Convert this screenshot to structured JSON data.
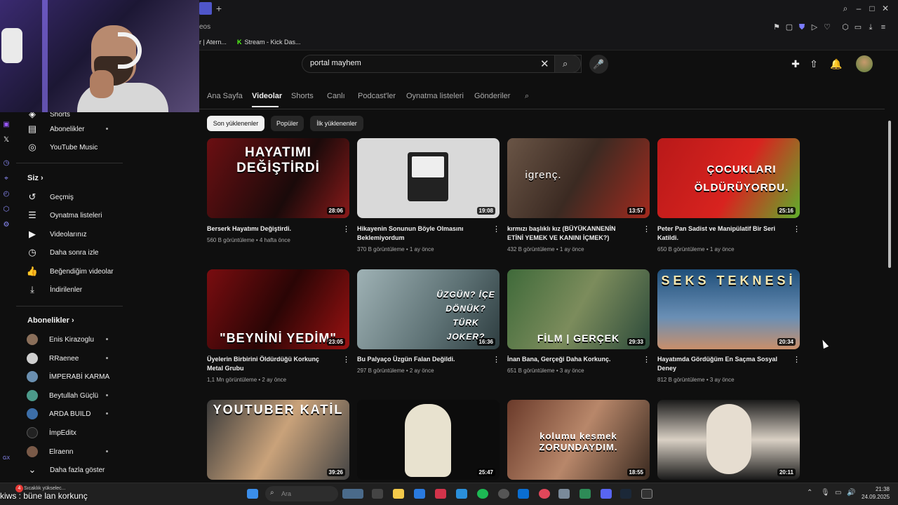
{
  "browser": {
    "url_fragment": "eos",
    "new_tab_label": "+",
    "bookmarks": [
      {
        "label": "r | Atern..."
      },
      {
        "label": "Stream - Kick Das..."
      }
    ],
    "window_controls": {
      "minimize": "–",
      "maximize": "□",
      "close": "✕"
    }
  },
  "search": {
    "query": "portal mayhem",
    "clear_icon": "✕",
    "search_icon": "⌕",
    "mic_icon": "🎤"
  },
  "sidebar": {
    "items_top": [
      {
        "label": "Shorts"
      },
      {
        "label": "Abonelikler"
      },
      {
        "label": "YouTube Music"
      }
    ],
    "you_heading": "Siz",
    "you_items": [
      {
        "label": "Geçmiş"
      },
      {
        "label": "Oynatma listeleri"
      },
      {
        "label": "Videolarınız"
      },
      {
        "label": "Daha sonra izle"
      },
      {
        "label": "Beğendiğim videolar"
      },
      {
        "label": "İndirilenler"
      }
    ],
    "subs_heading": "Abonelikler",
    "subscriptions": [
      {
        "label": "Enis Kirazoglu",
        "color": "#8a6f5a"
      },
      {
        "label": "RRaenee",
        "color": "#cfcfcf"
      },
      {
        "label": "İMPERABİ KARMA",
        "color": "#6a8fb0"
      },
      {
        "label": "Beytullah Güçlü",
        "color": "#4c9a8a"
      },
      {
        "label": "ARDA BUILD",
        "color": "#3c6ea8"
      },
      {
        "label": "İmpEditx",
        "color": "#222"
      },
      {
        "label": "Elraenn",
        "color": "#7a5a48"
      }
    ],
    "show_more": "Daha fazla göster"
  },
  "channel_tabs": [
    {
      "label": "Ana Sayfa"
    },
    {
      "label": "Videolar"
    },
    {
      "label": "Shorts"
    },
    {
      "label": "Canlı"
    },
    {
      "label": "Podcast'ler"
    },
    {
      "label": "Oynatma listeleri"
    },
    {
      "label": "Gönderiler"
    }
  ],
  "chips": [
    {
      "label": "Son yüklenenler"
    },
    {
      "label": "Popüler"
    },
    {
      "label": "İlk yüklenenler"
    }
  ],
  "videos": [
    {
      "thumb_text": "HAYATIMI DEĞİŞTİRDİ",
      "duration": "28:06",
      "title": "Berserk Hayatımı Değiştirdi.",
      "meta": "560 B görüntüleme • 4 hafta önce",
      "bg": "linear-gradient(120deg,#6b0f12,#1a0a0a 60%,#8a1a1a)"
    },
    {
      "thumb_text": "",
      "duration": "19:08",
      "title": "Hikayenin Sonunun Böyle Olmasını Beklemiyordum",
      "meta": "370 B görüntüleme • 1 ay önce",
      "bg": "#d9d9d9"
    },
    {
      "thumb_text": "igrenç.",
      "duration": "13:57",
      "title": "kırmızı başlıklı kız (BÜYÜKANNENİN ETİNİ YEMEK VE KANINI İÇMEK?)",
      "meta": "432 B görüntüleme • 1 ay önce",
      "bg": "linear-gradient(120deg,#6a5546,#3b2a22 50%,#a22a1e)"
    },
    {
      "thumb_text": "ÇOCUKLARI ÖLDÜRÜYORDU.",
      "duration": "25:16",
      "title": "Peter Pan Sadist ve Manipülatif Bir Seri Katildi.",
      "meta": "650 B görüntüleme • 1 ay önce",
      "bg": "linear-gradient(120deg,#b81919,#d8231f 55%,#5fae2b)"
    },
    {
      "thumb_text": "\"BEYNİNİ YEDİM\"",
      "duration": "23:05",
      "title": "Üyelerin Birbirini Öldürdüğü Korkunç Metal Grubu",
      "meta": "1,1 Mn görüntüleme • 2 ay önce",
      "bg": "linear-gradient(120deg,#7a0d10,#2a0505 50%,#9a1212)"
    },
    {
      "thumb_text": "ÜZGÜN? İÇE DÖNÜK? TÜRK JOKER?",
      "duration": "16:36",
      "title": "Bu Palyaço Üzgün Falan Değildi.",
      "meta": "297 B görüntüleme • 2 ay önce",
      "bg": "linear-gradient(120deg,#9fb2b5,#5c7073 60%,#2e3d40)"
    },
    {
      "thumb_text": "FİLM | GERÇEK",
      "duration": "29:33",
      "title": "İnan Bana, Gerçeği Daha Korkunç.",
      "meta": "651 B görüntüleme • 3 ay önce",
      "bg": "linear-gradient(120deg,#3f6a3a,#7c8c5c 50%,#2c4a3a)"
    },
    {
      "thumb_text": "SEKS TEKNESİ",
      "duration": "20:34",
      "title": "Hayatımda Gördüğüm En Saçma Sosyal Deney",
      "meta": "812 B görüntüleme • 3 ay önce",
      "bg": "linear-gradient(180deg,#1f4f7a,#6a8fb5 60%,#c98f6a)"
    },
    {
      "thumb_text": "YOUTUBER KATİL",
      "duration": "39:26",
      "title": "",
      "meta": "",
      "bg": "linear-gradient(120deg,#3a3a3a,#c9a27a 50%,#444)"
    },
    {
      "thumb_text": "",
      "duration": "25:47",
      "title": "",
      "meta": "",
      "bg": "#0c0c0c"
    },
    {
      "thumb_text": "kolumu kesmek ZORUNDAYDIM.",
      "duration": "18:55",
      "title": "",
      "meta": "",
      "bg": "linear-gradient(120deg,#6a3a2a,#b8876a 50%,#3a2a20)"
    },
    {
      "thumb_text": "",
      "duration": "20:11",
      "title": "",
      "meta": "",
      "bg": "linear-gradient(180deg,#1a1a1a,#d9d0c4 50%,#1a1a1a)"
    }
  ],
  "taskbar": {
    "search_placeholder": "Ara",
    "time": "21:38",
    "date": "24.09.2025",
    "weather": "Sıcaklık yükselec...",
    "notification_count": "4"
  },
  "chat_overlay": {
    "message": "kiws : büne lan korkunç"
  }
}
